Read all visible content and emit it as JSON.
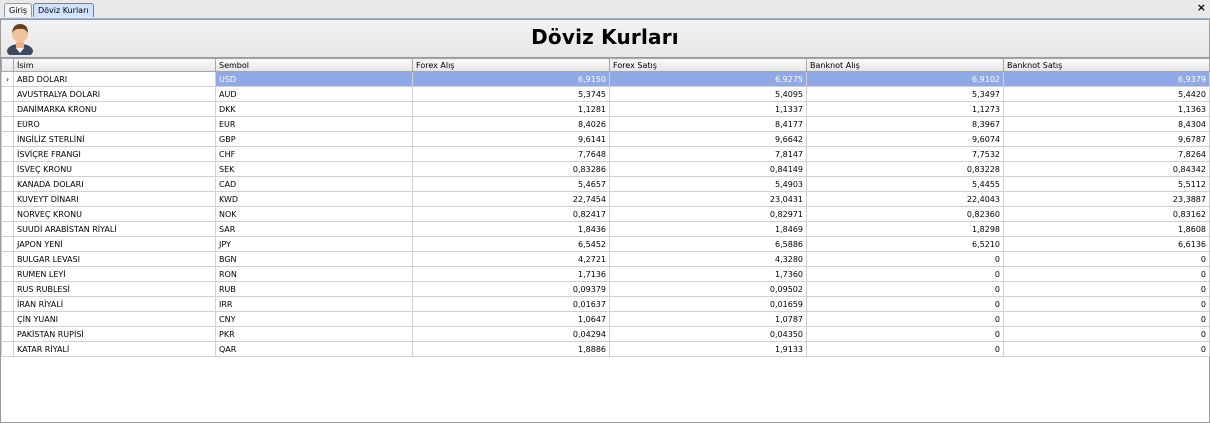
{
  "tabs": [
    {
      "label": "Giriş",
      "active": false
    },
    {
      "label": "Döviz Kurları",
      "active": true
    }
  ],
  "close_glyph": "×",
  "header": {
    "title": "Döviz Kurları",
    "icon": "user-avatar-icon"
  },
  "selection_marker": "›",
  "table": {
    "columns": [
      "İsim",
      "Sembol",
      "Forex Alış",
      "Forex Satış",
      "Banknot Alış",
      "Banknot Satış"
    ],
    "selected_row": 0,
    "rows": [
      [
        "ABD DOLARI",
        "USD",
        "6,9150",
        "6,9275",
        "6,9102",
        "6,9379"
      ],
      [
        "AVUSTRALYA DOLARI",
        "AUD",
        "5,3745",
        "5,4095",
        "5,3497",
        "5,4420"
      ],
      [
        "DANİMARKA KRONU",
        "DKK",
        "1,1281",
        "1,1337",
        "1,1273",
        "1,1363"
      ],
      [
        "EURO",
        "EUR",
        "8,4026",
        "8,4177",
        "8,3967",
        "8,4304"
      ],
      [
        "İNGİLİZ STERLİNİ",
        "GBP",
        "9,6141",
        "9,6642",
        "9,6074",
        "9,6787"
      ],
      [
        "İSVİÇRE FRANGI",
        "CHF",
        "7,7648",
        "7,8147",
        "7,7532",
        "7,8264"
      ],
      [
        "İSVEÇ KRONU",
        "SEK",
        "0,83286",
        "0,84149",
        "0,83228",
        "0,84342"
      ],
      [
        "KANADA DOLARI",
        "CAD",
        "5,4657",
        "5,4903",
        "5,4455",
        "5,5112"
      ],
      [
        "KUVEYT DİNARI",
        "KWD",
        "22,7454",
        "23,0431",
        "22,4043",
        "23,3887"
      ],
      [
        "NORVEÇ KRONU",
        "NOK",
        "0,82417",
        "0,82971",
        "0,82360",
        "0,83162"
      ],
      [
        "SUUDİ ARABİSTAN RİYALİ",
        "SAR",
        "1,8436",
        "1,8469",
        "1,8298",
        "1,8608"
      ],
      [
        "JAPON YENİ",
        "JPY",
        "6,5452",
        "6,5886",
        "6,5210",
        "6,6136"
      ],
      [
        "BULGAR LEVASI",
        "BGN",
        "4,2721",
        "4,3280",
        "0",
        "0"
      ],
      [
        "RUMEN LEYİ",
        "RON",
        "1,7136",
        "1,7360",
        "0",
        "0"
      ],
      [
        "RUS RUBLESİ",
        "RUB",
        "0,09379",
        "0,09502",
        "0",
        "0"
      ],
      [
        "İRAN RİYALİ",
        "IRR",
        "0,01637",
        "0,01659",
        "0",
        "0"
      ],
      [
        "ÇİN YUANI",
        "CNY",
        "1,0647",
        "1,0787",
        "0",
        "0"
      ],
      [
        "PAKİSTAN RUPİSİ",
        "PKR",
        "0,04294",
        "0,04350",
        "0",
        "0"
      ],
      [
        "KATAR RİYALİ",
        "QAR",
        "1,8886",
        "1,9133",
        "0",
        "0"
      ]
    ]
  },
  "colors": {
    "selected_row": "#8ea9e6",
    "active_tab": "#cfe3fb"
  }
}
